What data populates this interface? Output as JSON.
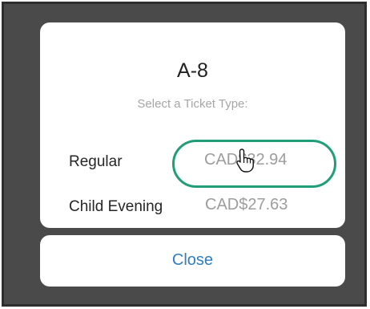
{
  "dialog": {
    "title": "A-8",
    "subtitle": "Select a Ticket Type:",
    "tickets": [
      {
        "label": "Regular",
        "price": "CAD$32.94"
      },
      {
        "label": "Child Evening",
        "price": "CAD$27.63"
      }
    ]
  },
  "actions": {
    "close_label": "Close"
  },
  "colors": {
    "highlight": "#1f9e78",
    "link": "#2f7ec0",
    "backdrop": "#4a4a4a"
  },
  "icons": {
    "pointer": "hand-pointer-icon"
  }
}
